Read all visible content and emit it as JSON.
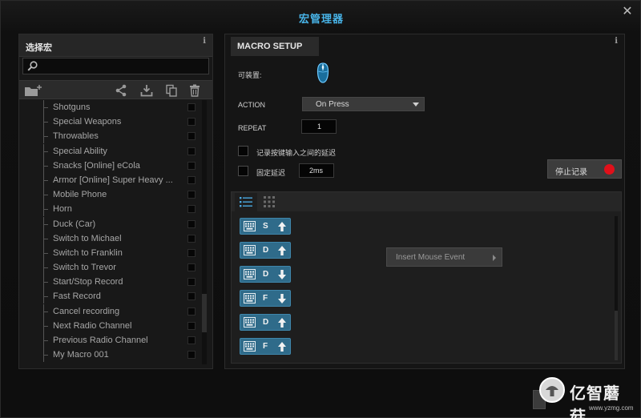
{
  "window": {
    "title": "宏管理器",
    "close_glyph": "✕"
  },
  "left_panel": {
    "title": "选择宏",
    "info": "i",
    "search": {
      "value": "",
      "placeholder": ""
    },
    "toolbar_icons": [
      "new-folder-icon",
      "share-icon",
      "import-icon",
      "duplicate-icon",
      "delete-icon"
    ],
    "macros": [
      "Shotguns",
      "Special Weapons",
      "Throwables",
      "Special Ability",
      "Snacks [Online] eCola",
      "Armor [Online] Super Heavy ...",
      "Mobile Phone",
      "Horn",
      "Duck (Car)",
      "Switch to Michael",
      "Switch to Franklin",
      "Switch to Trevor",
      "Start/Stop Record",
      "Fast Record",
      "Cancel recording",
      "Next Radio Channel",
      "Previous Radio Channel",
      "My Macro 001"
    ]
  },
  "right_panel": {
    "title": "MACRO SETUP",
    "info": "i",
    "device_label": "可装置:",
    "action_label": "ACTION",
    "action_value": "On Press",
    "repeat_label": "REPEAT",
    "repeat_value": "1",
    "record_delay_label": "记录按键输入之间的延迟",
    "fixed_delay_label": "固定延迟",
    "fixed_delay_value": "2ms",
    "stop_record_label": "停止记录",
    "insert_mouse_event_label": "Insert Mouse Event",
    "key_events": [
      {
        "key": "S",
        "direction": "up"
      },
      {
        "key": "D",
        "direction": "up"
      },
      {
        "key": "D",
        "direction": "down"
      },
      {
        "key": "F",
        "direction": "down"
      },
      {
        "key": "D",
        "direction": "up"
      },
      {
        "key": "F",
        "direction": "up"
      }
    ]
  },
  "watermark": {
    "text": "亿智蘑菇",
    "url": "www.yzmg.com"
  },
  "colors": {
    "accent": "#48b4e8",
    "key_event": "#2f6b8a",
    "record_dot": "#e0101a"
  }
}
